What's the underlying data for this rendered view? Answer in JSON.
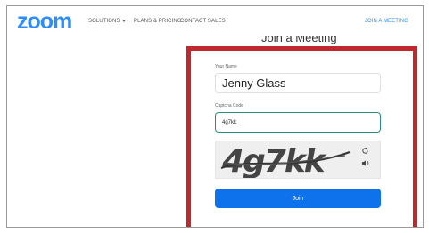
{
  "header": {
    "logo": "zoom",
    "nav": {
      "solutions": "SOLUTIONS",
      "plans": "PLANS & PRICING",
      "contact": "CONTACT SALES",
      "join": "JOIN A MEETING"
    }
  },
  "main": {
    "heading": "Join a Meeting"
  },
  "form": {
    "name_label": "Your Name",
    "name_value": "Jenny Glass",
    "captcha_label": "Captcha Code",
    "captcha_value": "4g7kk",
    "captcha_image_text": "4g7kk",
    "join_label": "Join"
  },
  "colors": {
    "brand": "#2d8cff",
    "join_button": "#0e72ed",
    "highlight_border": "#c0282e"
  },
  "icons": {
    "refresh": "refresh-icon",
    "audio": "audio-icon",
    "caret": "chevron-down-icon"
  }
}
